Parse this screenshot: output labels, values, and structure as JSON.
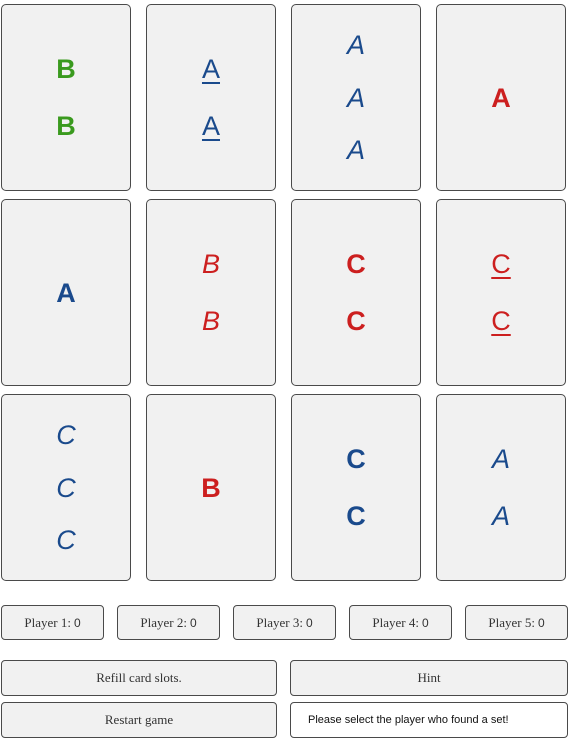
{
  "colors": {
    "green": "#3a9a1e",
    "blue": "#1a4a8c",
    "red": "#cc1f1f"
  },
  "cards": [
    {
      "letter": "B",
      "count": 2,
      "color": "green",
      "style": "bold"
    },
    {
      "letter": "A",
      "count": 2,
      "color": "blue",
      "style": "underline"
    },
    {
      "letter": "A",
      "count": 3,
      "color": "blue",
      "style": "italic"
    },
    {
      "letter": "A",
      "count": 1,
      "color": "red",
      "style": "bold"
    },
    {
      "letter": "A",
      "count": 1,
      "color": "blue",
      "style": "bold"
    },
    {
      "letter": "B",
      "count": 2,
      "color": "red",
      "style": "italic"
    },
    {
      "letter": "C",
      "count": 2,
      "color": "red",
      "style": "bold"
    },
    {
      "letter": "C",
      "count": 2,
      "color": "red",
      "style": "underline"
    },
    {
      "letter": "C",
      "count": 3,
      "color": "blue",
      "style": "italic"
    },
    {
      "letter": "B",
      "count": 1,
      "color": "red",
      "style": "bold"
    },
    {
      "letter": "C",
      "count": 2,
      "color": "blue",
      "style": "bold"
    },
    {
      "letter": "A",
      "count": 2,
      "color": "blue",
      "style": "italic"
    }
  ],
  "players": [
    {
      "label": "Player 1:",
      "score": "0"
    },
    {
      "label": "Player 2:",
      "score": "0"
    },
    {
      "label": "Player 3:",
      "score": "0"
    },
    {
      "label": "Player 4:",
      "score": "0"
    },
    {
      "label": "Player 5:",
      "score": "0"
    }
  ],
  "controls": {
    "refill_label": "Refill card slots.",
    "hint_label": "Hint",
    "restart_label": "Restart game",
    "status_text": "Please select the player who found a set!"
  }
}
